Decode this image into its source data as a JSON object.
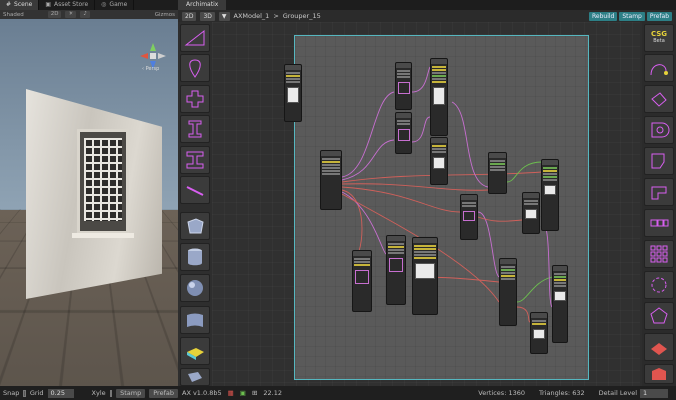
{
  "scene_panel": {
    "tabs": [
      {
        "label": "Scene",
        "icon": "scene-icon"
      },
      {
        "label": "Asset Store",
        "icon": "store-icon"
      },
      {
        "label": "Game",
        "icon": "game-icon"
      }
    ],
    "toolbar": {
      "shading": "Shaded",
      "mode_2d": "2D",
      "gizmos": "Gizmos"
    },
    "perspective_label": "‹ Persp"
  },
  "archimatix": {
    "tab_label": "Archimatix",
    "mode_2d": "2D",
    "mode_3d": "3D",
    "breadcrumb_model": "AXModel_1",
    "breadcrumb_separator": ">",
    "breadcrumb_grouper": "Grouper_15",
    "buttons": {
      "rebuild": "Rebuild",
      "stamp": "Stamp",
      "prefab": "Prefab"
    },
    "left_tools": [
      "triangle-shape-icon",
      "teardrop-shape-icon",
      "cross-shape-icon",
      "i-beam-icon",
      "wide-i-beam-icon",
      "line-shape-icon",
      "cube-icon",
      "cylinder-icon",
      "sphere-icon",
      "plane-icon",
      "extrude-icon",
      "box-icon"
    ],
    "right_tools": [
      "curve-point-icon",
      "node-graph-icon",
      "offset-shape-icon",
      "corner-shape-icon",
      "l-shape-icon",
      "chain-shape-icon",
      "grid-repeater-icon",
      "radial-repeater-icon",
      "polygon-repeater-icon",
      "floor-icon",
      "cube-repeater-icon"
    ],
    "csg": {
      "title": "CSG",
      "subtitle": "Beta"
    }
  },
  "status_bar": {
    "snap_label": "Snap",
    "grid_label": "Grid",
    "grid_value": "0.25",
    "xyle_label": "Xyle",
    "stamp_label": "Stamp",
    "prefab_label": "Prefab",
    "version": "AX v1.0.8b5",
    "zoom": "22.12",
    "vertices_label": "Vertices:",
    "vertices_value": "1360",
    "triangles_label": "Triangles:",
    "triangles_value": "632",
    "detail_label": "Detail Level",
    "detail_value": "1"
  },
  "colors": {
    "accent_teal": "#2d7f86",
    "area_border": "#56b7c0",
    "wire_pink": "#c76fd0",
    "wire_red": "#d0605a",
    "wire_green": "#6cbf4f",
    "csg_yellow": "#e6d23a",
    "icon_magenta": "#d85ff0"
  }
}
